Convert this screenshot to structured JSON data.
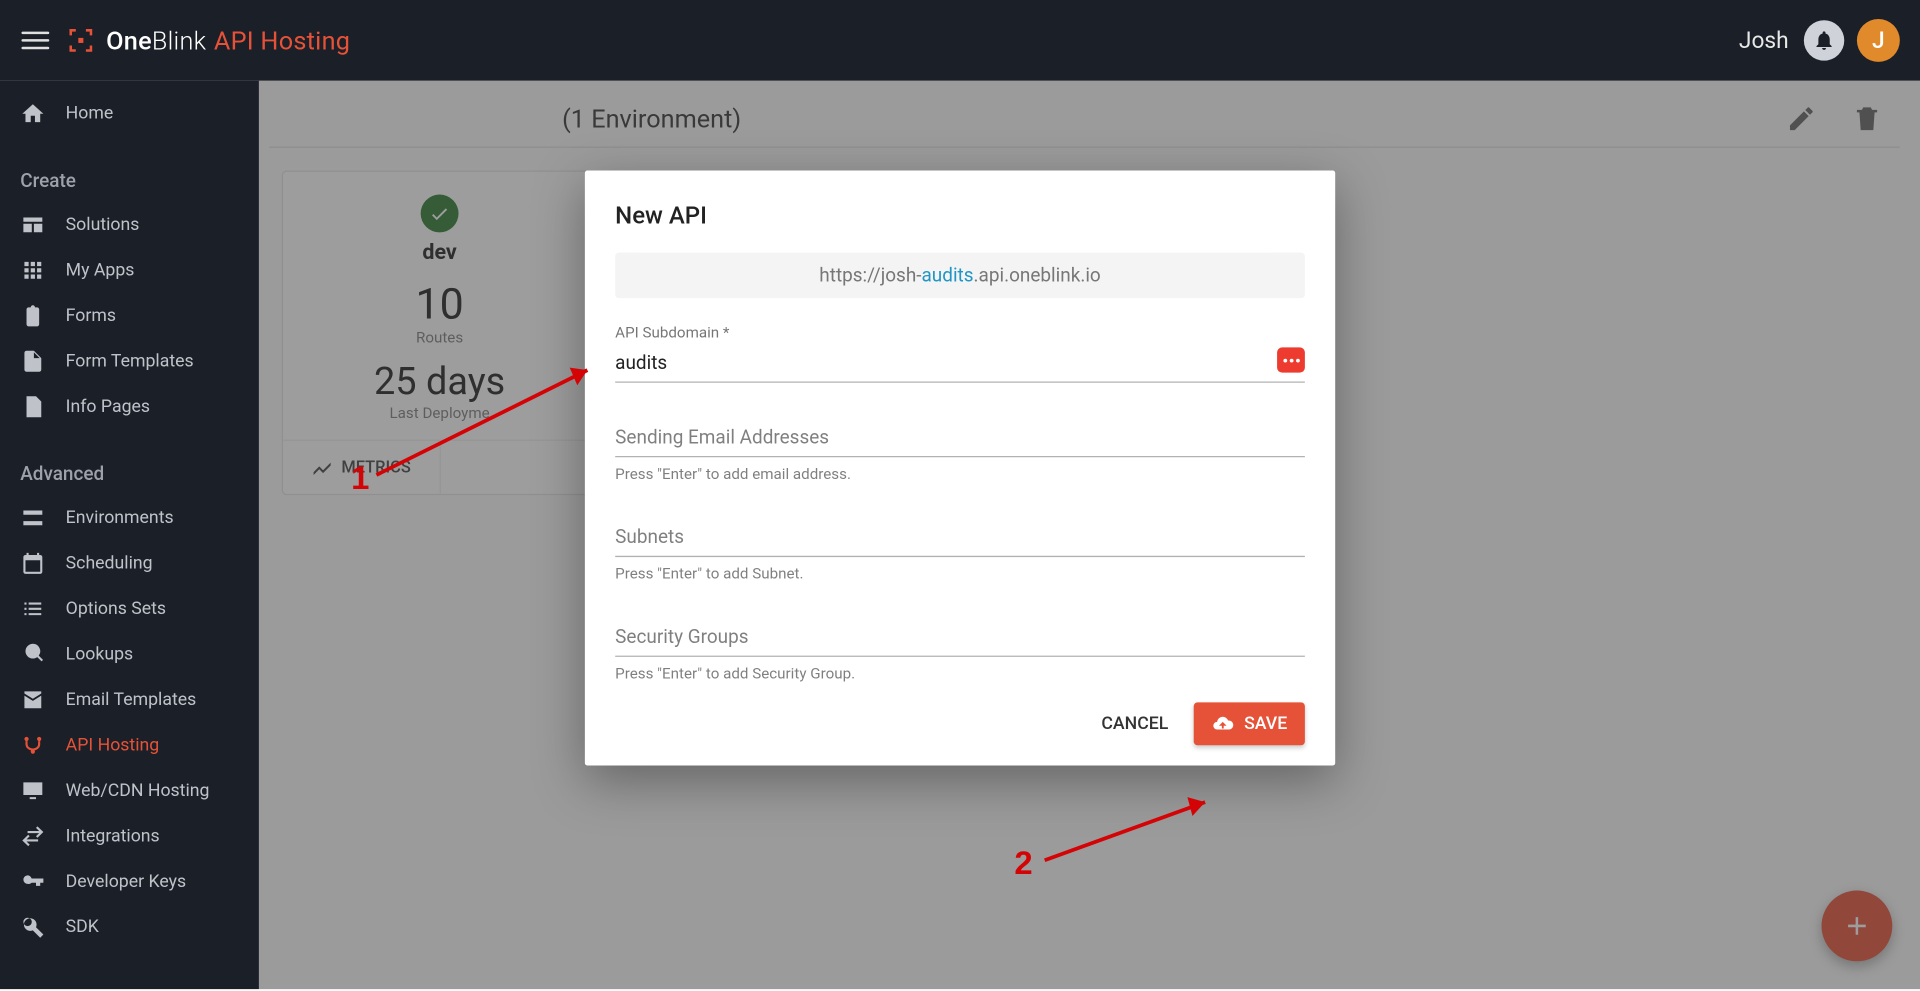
{
  "appbar": {
    "brand_one": "One",
    "brand_blink": "Blink",
    "brand_api": "API Hosting",
    "user_name": "Josh",
    "avatar_initial": "J"
  },
  "sidebar": {
    "home": "Home",
    "section_create": "Create",
    "solutions": "Solutions",
    "my_apps": "My Apps",
    "forms": "Forms",
    "form_templates": "Form Templates",
    "info_pages": "Info Pages",
    "section_advanced": "Advanced",
    "environments": "Environments",
    "scheduling": "Scheduling",
    "options_sets": "Options Sets",
    "lookups": "Lookups",
    "email_templates": "Email Templates",
    "api_hosting": "API Hosting",
    "web_cdn_hosting": "Web/CDN Hosting",
    "integrations": "Integrations",
    "developer_keys": "Developer Keys",
    "sdk": "SDK"
  },
  "page": {
    "title": "(1 Environment)"
  },
  "card": {
    "env_name": "dev",
    "routes_value": "10",
    "routes_label": "Routes",
    "last_deploy_value": "25 days",
    "last_deploy_label": "Last Deployme",
    "metrics_btn": "METRICS"
  },
  "dialog": {
    "title": "New API",
    "url_prefix": "https://josh-",
    "url_highlight": "audits",
    "url_suffix": ".api.oneblink.io",
    "subdomain_label": "API Subdomain *",
    "subdomain_value": "audits",
    "email_label": "Sending Email Addresses",
    "email_help": "Press \"Enter\" to add email address.",
    "subnets_label": "Subnets",
    "subnets_help": "Press \"Enter\" to add Subnet.",
    "secgroups_label": "Security Groups",
    "secgroups_help": "Press \"Enter\" to add Security Group.",
    "cancel": "CANCEL",
    "save": "SAVE"
  },
  "annotations": {
    "one": "1",
    "two": "2"
  }
}
